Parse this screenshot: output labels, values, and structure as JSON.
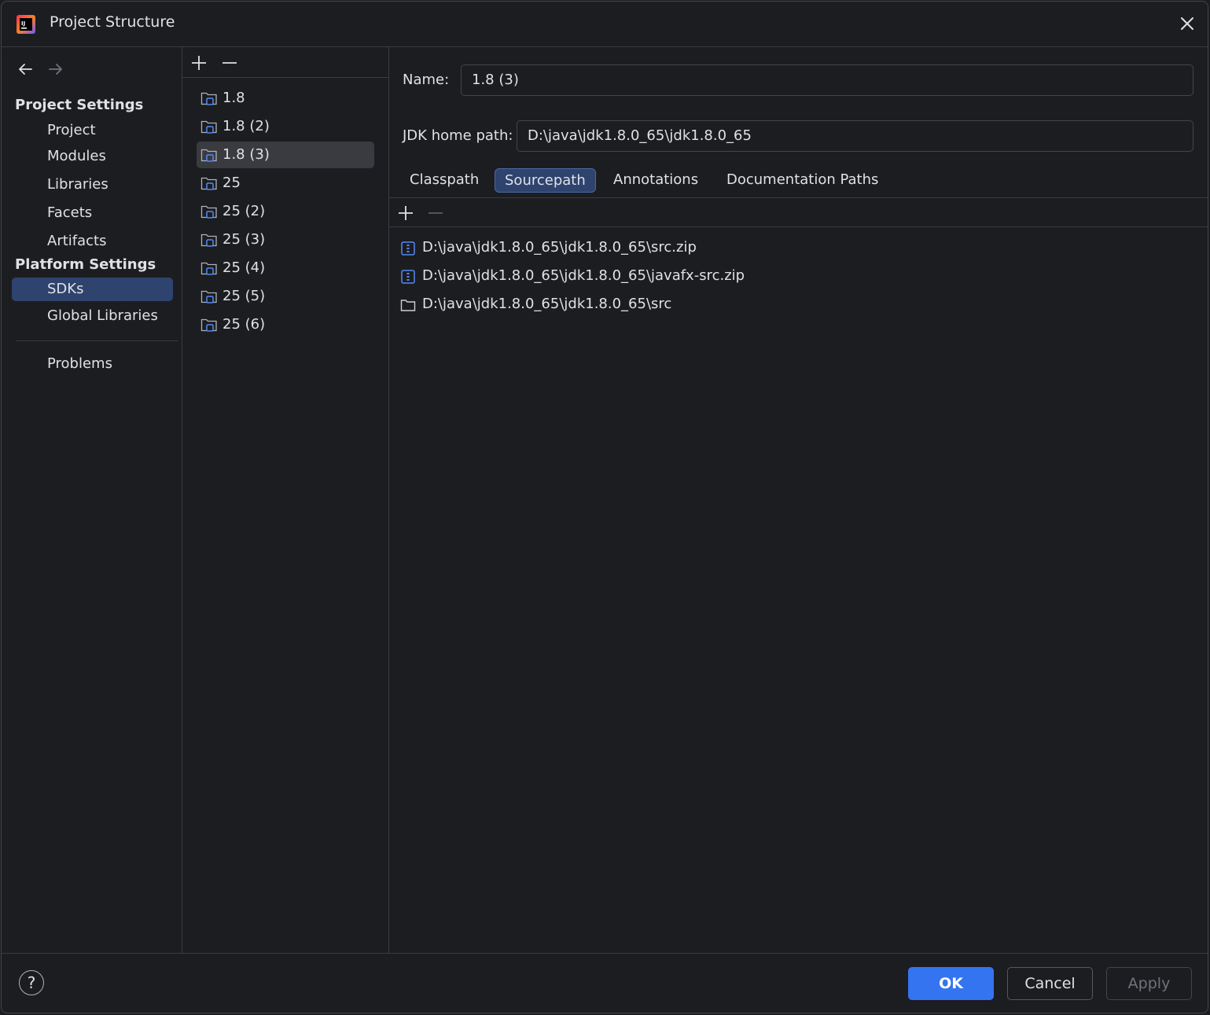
{
  "window": {
    "title": "Project Structure"
  },
  "nav": {
    "project_settings_header": "Project Settings",
    "project_items": [
      {
        "label": "Project"
      },
      {
        "label": "Modules"
      },
      {
        "label": "Libraries"
      },
      {
        "label": "Facets"
      },
      {
        "label": "Artifacts"
      }
    ],
    "platform_settings_header": "Platform Settings",
    "platform_items": [
      {
        "label": "SDKs",
        "selected": true
      },
      {
        "label": "Global Libraries"
      }
    ],
    "problems_label": "Problems"
  },
  "sdk_list": {
    "items": [
      {
        "label": "1.8"
      },
      {
        "label": "1.8 (2)"
      },
      {
        "label": "1.8 (3)",
        "selected": true
      },
      {
        "label": "25"
      },
      {
        "label": "25 (2)"
      },
      {
        "label": "25 (3)"
      },
      {
        "label": "25 (4)"
      },
      {
        "label": "25 (5)"
      },
      {
        "label": "25 (6)"
      }
    ]
  },
  "detail": {
    "name_label": "Name:",
    "name_value": "1.8 (3)",
    "jdk_home_label": "JDK home path:",
    "jdk_home_value": "D:\\java\\jdk1.8.0_65\\jdk1.8.0_65",
    "tabs": [
      {
        "label": "Classpath"
      },
      {
        "label": "Sourcepath",
        "selected": true
      },
      {
        "label": "Annotations"
      },
      {
        "label": "Documentation Paths"
      }
    ],
    "paths": [
      {
        "label": "D:\\java\\jdk1.8.0_65\\jdk1.8.0_65\\src.zip",
        "icon": "archive-icon"
      },
      {
        "label": "D:\\java\\jdk1.8.0_65\\jdk1.8.0_65\\javafx-src.zip",
        "icon": "archive-icon"
      },
      {
        "label": "D:\\java\\jdk1.8.0_65\\jdk1.8.0_65\\src",
        "icon": "folder-icon"
      }
    ]
  },
  "footer": {
    "help_label": "?",
    "ok_label": "OK",
    "cancel_label": "Cancel",
    "apply_label": "Apply"
  },
  "colors": {
    "background": "#1c1d20",
    "selection": "#2e436e",
    "accent": "#3574f0",
    "border": "#393b40",
    "text": "#dfe1e5",
    "disabled_text": "#6f737a"
  }
}
